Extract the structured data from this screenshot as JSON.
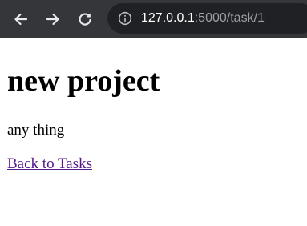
{
  "browser": {
    "url_host": "127.0.0.1",
    "url_rest": ":5000/task/1",
    "icons": {
      "back": "arrow-left-icon",
      "forward": "arrow-right-icon",
      "reload": "reload-icon",
      "info": "info-icon"
    }
  },
  "page": {
    "title": "new project",
    "description": "any thing",
    "back_link": "Back to Tasks"
  },
  "colors": {
    "toolbar": "#35363a",
    "omnibox": "#202124",
    "link_visited": "#551a8b"
  }
}
